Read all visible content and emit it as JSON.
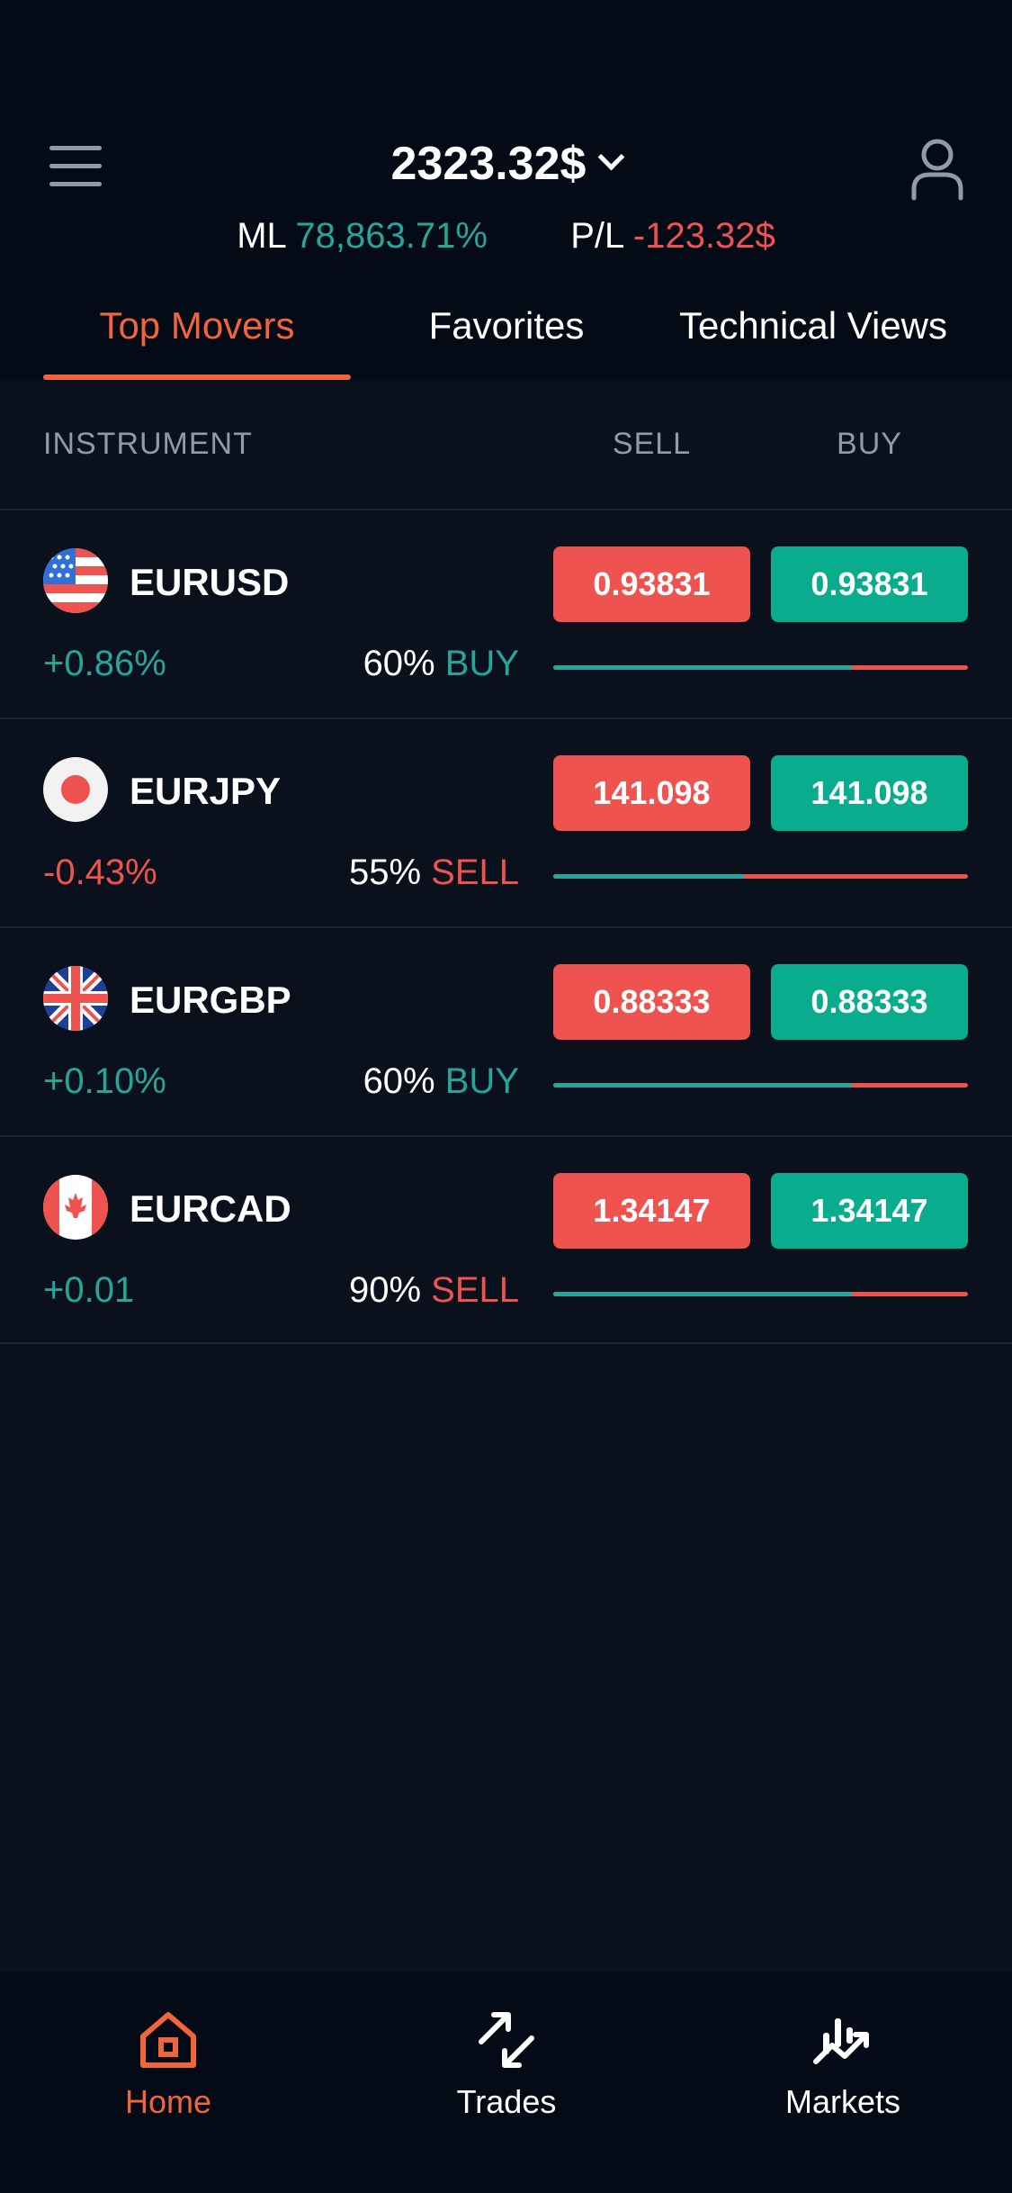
{
  "header": {
    "balance": "2323.32$",
    "ml_label": "ML",
    "ml_value": "78,863.71%",
    "pl_label": "P/L",
    "pl_value": "-123.32$"
  },
  "tabs": [
    {
      "label": "Top Movers",
      "active": true
    },
    {
      "label": "Favorites",
      "active": false
    },
    {
      "label": "Technical Views",
      "active": false
    }
  ],
  "columns": {
    "instrument": "INSTRUMENT",
    "sell": "SELL",
    "buy": "BUY"
  },
  "instruments": [
    {
      "symbol": "EURUSD",
      "flag": "us-flag-icon",
      "change": "+0.86%",
      "change_dir": "pos",
      "sentiment_pct": "60%",
      "sentiment_side": "BUY",
      "sell": "0.93831",
      "buy": "0.93831",
      "buy_ratio": 0.72
    },
    {
      "symbol": "EURJPY",
      "flag": "jp-flag-icon",
      "change": "-0.43%",
      "change_dir": "neg",
      "sentiment_pct": "55%",
      "sentiment_side": "SELL",
      "sell": "141.098",
      "buy": "141.098",
      "buy_ratio": 0.46
    },
    {
      "symbol": "EURGBP",
      "flag": "gb-flag-icon",
      "change": "+0.10%",
      "change_dir": "pos",
      "sentiment_pct": "60%",
      "sentiment_side": "BUY",
      "sell": "0.88333",
      "buy": "0.88333",
      "buy_ratio": 0.72
    },
    {
      "symbol": "EURCAD",
      "flag": "ca-flag-icon",
      "change": "+0.01",
      "change_dir": "pos",
      "sentiment_pct": "90%",
      "sentiment_side": "SELL",
      "sell": "1.34147",
      "buy": "1.34147",
      "buy_ratio": 0.72
    }
  ],
  "nav": [
    {
      "label": "Home",
      "icon": "home-icon",
      "active": true
    },
    {
      "label": "Trades",
      "icon": "trades-icon",
      "active": false
    },
    {
      "label": "Markets",
      "icon": "markets-icon",
      "active": false
    }
  ],
  "colors": {
    "accent": "#f0653a",
    "positive": "#26a69a",
    "negative": "#ef5350",
    "buy_button": "#09ad8e",
    "background": "#0b101d"
  }
}
